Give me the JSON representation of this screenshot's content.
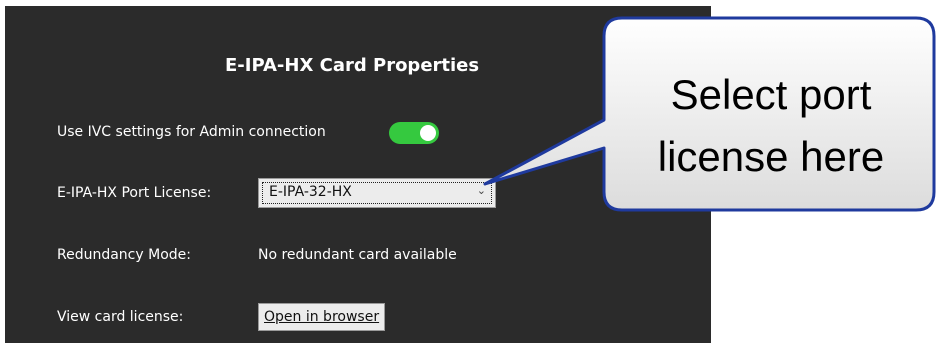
{
  "dialog": {
    "title": "E-IPA-HX Card Properties",
    "admin_setting_label": "Use IVC settings for Admin connection",
    "admin_toggle_state": "on",
    "port_license_label": "E-IPA-HX Port License:",
    "port_license_value": "E-IPA-32-HX",
    "redundancy_label": "Redundancy Mode:",
    "redundancy_value": "No redundant card available",
    "view_license_label": "View card license:",
    "open_browser_label": "Open in browser"
  },
  "callout": {
    "line1": "Select port",
    "line2": "license here"
  },
  "colors": {
    "panel_bg": "#2b2b2b",
    "toggle_on": "#35c93f",
    "callout_border": "#1f3a9e"
  },
  "icons": {
    "dropdown": "chevron-down-icon"
  }
}
